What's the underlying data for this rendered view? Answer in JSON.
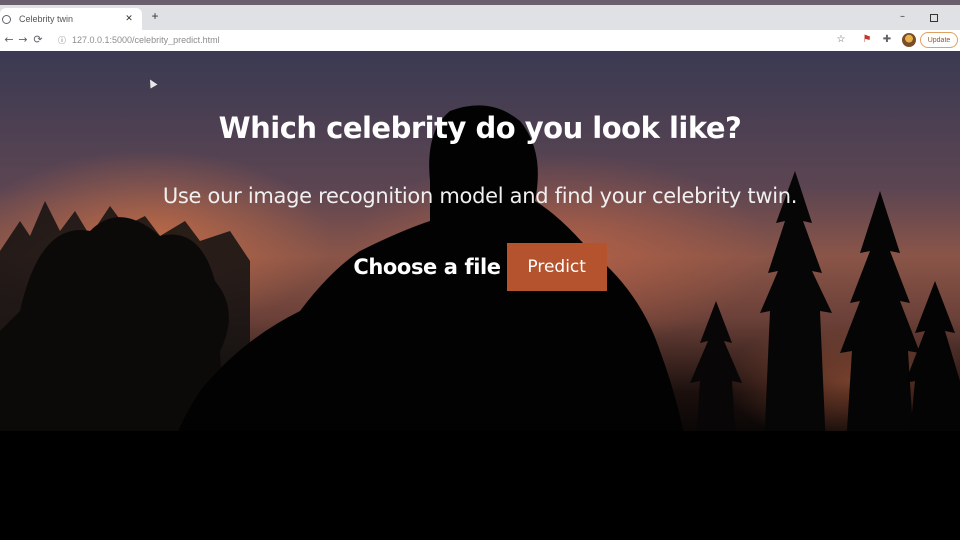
{
  "browser": {
    "tab_title": "Celebrity twin",
    "tab_close": "✕",
    "new_tab": "+",
    "window_minimize": "–",
    "url": "127.0.0.1:5000/celebrity_predict.html",
    "update_label": "Update",
    "icons": {
      "back": "←",
      "forward": "→",
      "reload": "⟳",
      "home": "⌂",
      "lock": "ⓘ",
      "star": "☆",
      "extension": "⚑",
      "puzzle": "✚"
    }
  },
  "page": {
    "title": "Which celebrity do you look like?",
    "subtitle": "Use our image recognition model and find your celebrity twin.",
    "choose_file_label": "Choose a file",
    "predict_label": "Predict"
  },
  "colors": {
    "predict_button": "#b5532f",
    "sky_top": "#3a3a52",
    "sky_glow": "#c86e46"
  }
}
